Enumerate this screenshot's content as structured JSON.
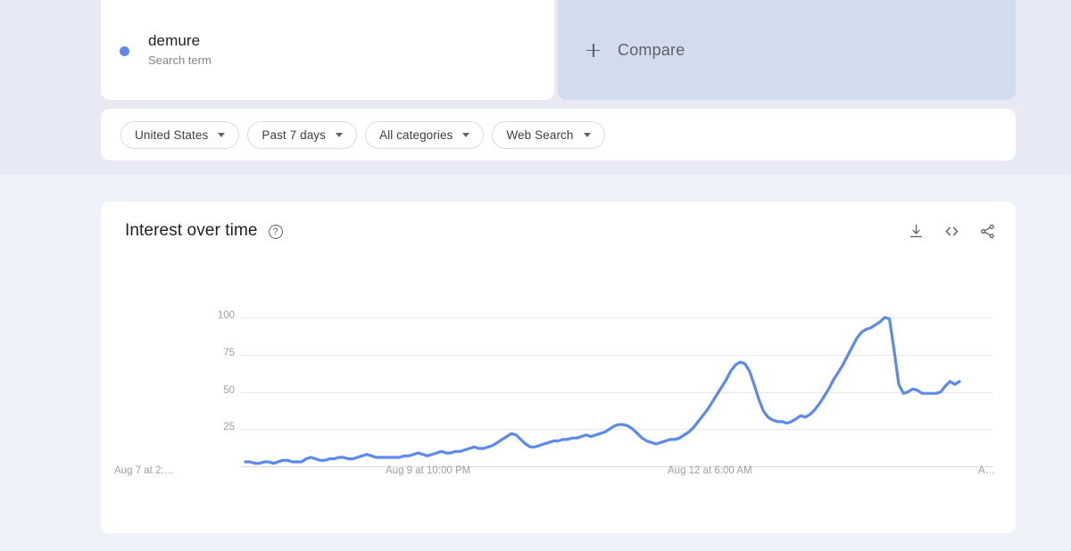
{
  "search_card": {
    "term": "demure",
    "subtitle": "Search term",
    "dot_color": "#5B8AEF"
  },
  "compare_card": {
    "label": "Compare",
    "icon": "plus-icon",
    "background": "#D3DCEF"
  },
  "filters": [
    {
      "label": "United States",
      "name": "location-filter"
    },
    {
      "label": "Past 7 days",
      "name": "time-range-filter"
    },
    {
      "label": "All categories",
      "name": "category-filter"
    },
    {
      "label": "Web Search",
      "name": "search-type-filter"
    }
  ],
  "chart_card": {
    "title": "Interest over time",
    "help_icon": "help-circle-icon",
    "actions": [
      {
        "name": "download-icon",
        "label": "Download"
      },
      {
        "name": "embed-icon",
        "label": "Embed"
      },
      {
        "name": "share-icon",
        "label": "Share"
      }
    ]
  },
  "chart_data": {
    "type": "line",
    "title": "Interest over time",
    "xlabel": "",
    "ylabel": "",
    "ylim": [
      0,
      100
    ],
    "yticks": [
      25,
      50,
      75,
      100
    ],
    "xticks": [
      "Aug 7 at 2:…",
      "Aug 9 at 10:00 PM",
      "Aug 12 at 6:00 AM",
      "A…"
    ],
    "grid": true,
    "legend": false,
    "line_color": "#5B8AEF",
    "series": [
      {
        "name": "demure",
        "values": [
          3,
          3,
          2,
          2,
          3,
          3,
          2,
          3,
          4,
          4,
          3,
          3,
          3,
          5,
          6,
          5,
          4,
          4,
          5,
          5,
          6,
          6,
          5,
          5,
          6,
          7,
          8,
          7,
          6,
          6,
          6,
          6,
          6,
          6,
          7,
          7,
          8,
          9,
          8,
          7,
          8,
          9,
          10,
          9,
          9,
          10,
          10,
          11,
          12,
          13,
          12,
          12,
          13,
          14,
          16,
          18,
          20,
          22,
          21,
          18,
          15,
          13,
          13,
          14,
          15,
          16,
          17,
          17,
          18,
          18,
          19,
          19,
          20,
          21,
          20,
          21,
          22,
          23,
          25,
          27,
          28,
          28,
          27,
          25,
          22,
          19,
          17,
          16,
          15,
          16,
          17,
          18,
          18,
          19,
          21,
          23,
          26,
          30,
          34,
          38,
          43,
          48,
          53,
          58,
          64,
          68,
          70,
          69,
          64,
          55,
          45,
          37,
          33,
          31,
          30,
          30,
          29,
          30,
          32,
          34,
          33,
          35,
          38,
          42,
          47,
          52,
          58,
          63,
          68,
          74,
          80,
          86,
          90,
          92,
          93,
          95,
          97,
          100,
          99,
          78,
          55,
          49,
          50,
          52,
          51,
          49,
          49,
          49,
          49,
          50,
          54,
          57,
          55,
          57
        ]
      }
    ]
  }
}
